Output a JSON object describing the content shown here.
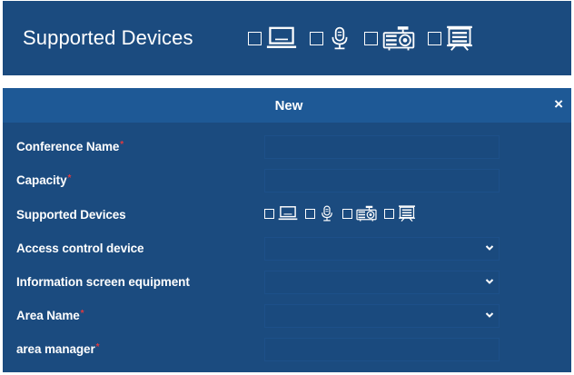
{
  "banner": {
    "title": "Supported Devices",
    "devices": [
      {
        "icon": "laptop-icon"
      },
      {
        "icon": "microphone-icon"
      },
      {
        "icon": "projector-icon"
      },
      {
        "icon": "projection-screen-icon"
      }
    ]
  },
  "dialog": {
    "title": "New",
    "close_label": "×",
    "fields": [
      {
        "label": "Conference Name",
        "required": "*",
        "type": "text",
        "value": ""
      },
      {
        "label": "Capacity",
        "required": "*",
        "type": "text",
        "value": ""
      },
      {
        "label": "Supported Devices",
        "required": "",
        "type": "devices"
      },
      {
        "label": "Access control device",
        "required": "",
        "type": "select",
        "value": ""
      },
      {
        "label": "Information screen equipment",
        "required": "",
        "type": "select",
        "value": ""
      },
      {
        "label": "Area Name",
        "required": "*",
        "type": "select",
        "value": ""
      },
      {
        "label": "area manager",
        "required": "*",
        "type": "text",
        "value": ""
      }
    ]
  },
  "colors": {
    "panel": "#1b4b7f",
    "header": "#1e5996",
    "required": "#e0393e",
    "text": "#ffffff"
  }
}
